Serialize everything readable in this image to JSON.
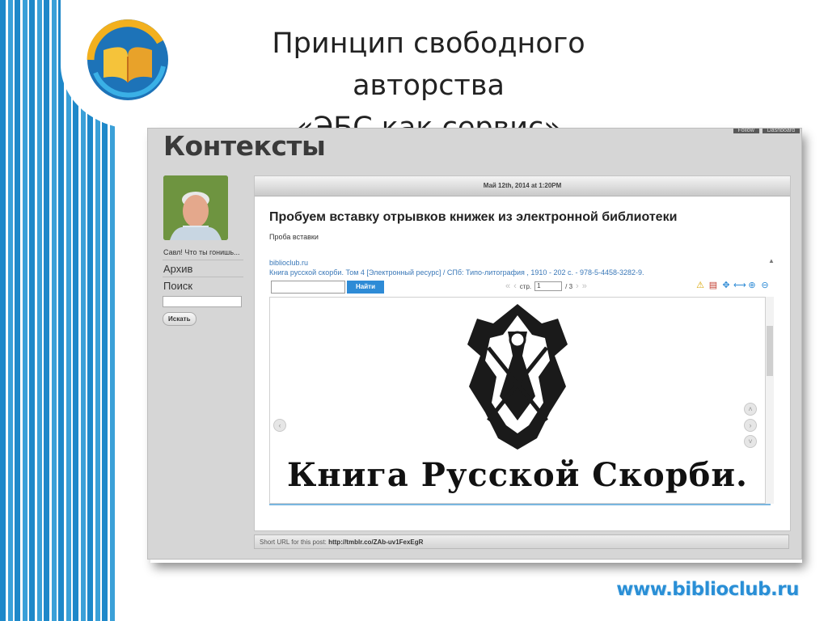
{
  "slide": {
    "title_line1": "Принцип свободного авторства",
    "title_line2": "«ЭБС как сервис»",
    "site_url": "www.biblioclub.ru"
  },
  "blog": {
    "top_buttons": [
      "Follow",
      "Dashboard"
    ],
    "heading": "Контексты",
    "side_caption": "Савл! Что ты гонишь...",
    "side_links": [
      "Архив",
      "Поиск"
    ],
    "search_button": "Искать",
    "post": {
      "date": "Май 12th, 2014 at 1:20PM",
      "title": "Пробуем вставку отрывков книжек из электронной библиотеки",
      "subtitle": "Проба вставки",
      "short_url_label": "Short URL for this post:",
      "short_url": "http://tmblr.co/ZAb-uv1FexEgR"
    },
    "embed": {
      "source_link": "biblioclub.ru",
      "book_link": "Книга русской скорби. Том 4 [Электронный ресурс] / СПб: Типо-литография , 1910 - 202 с. - 978-5-4458-3282-9.",
      "find_button": "Найти",
      "page_label": "стр.",
      "page_value": "1",
      "page_total": "/ 3",
      "book_page_title": "Книга Русской Скорби.",
      "tool_icons": [
        "warning-icon",
        "pdf-icon",
        "move-icon",
        "fit-width-icon",
        "zoom-in-icon",
        "zoom-out-icon"
      ]
    }
  },
  "colors": {
    "stripe_blue": "#1e88c9",
    "link_blue": "#3a78b8",
    "button_blue": "#2e8bd6",
    "site_url": "#2a8fd6"
  }
}
